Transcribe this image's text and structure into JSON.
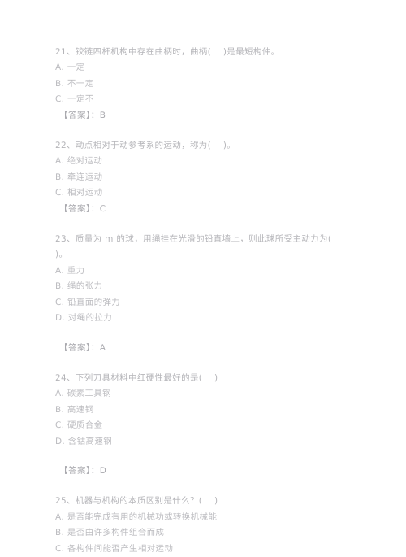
{
  "document": {
    "type": "exam-question-sheet",
    "language": "zh-CN",
    "text_color": "#b9b9bd",
    "background_color": "#ffffff",
    "answer_label": "【答案】",
    "questions": [
      {
        "number": "21",
        "stem": "21、铰链四杆机构中存在曲柄时，曲柄(    )是最短构件。",
        "options": [
          "A. 一定",
          "B. 不一定",
          "C. 一定不"
        ],
        "answer": "【答案】：B"
      },
      {
        "number": "22",
        "stem": "22、动点相对于动参考系的运动，称为(    )。",
        "options": [
          "A. 绝对运动",
          "B. 牵连运动",
          "C. 相对运动"
        ],
        "answer": "【答案】：C"
      },
      {
        "number": "23",
        "stem": "23、质量为 m 的球，用绳挂在光滑的铅直墙上，则此球所受主动力为(    )。",
        "options": [
          "A. 重力",
          "B. 绳的张力",
          "C. 铅直面的弹力",
          "D. 对绳的拉力"
        ],
        "answer": "【答案】：A"
      },
      {
        "number": "24",
        "stem": "24、下列刀具材料中红硬性最好的是(    )",
        "options": [
          "A. 碳素工具钢",
          "B. 高速钢",
          "C. 硬质合金",
          "D. 含钴高速钢"
        ],
        "answer": "【答案】：D"
      },
      {
        "number": "25",
        "stem": "25、机器与机构的本质区别是什么？(    )",
        "options": [
          "A. 是否能完成有用的机械功或转换机械能",
          "B. 是否由许多构件组合而成",
          "C. 各构件间能否产生相对运动"
        ],
        "answer": ""
      }
    ]
  }
}
